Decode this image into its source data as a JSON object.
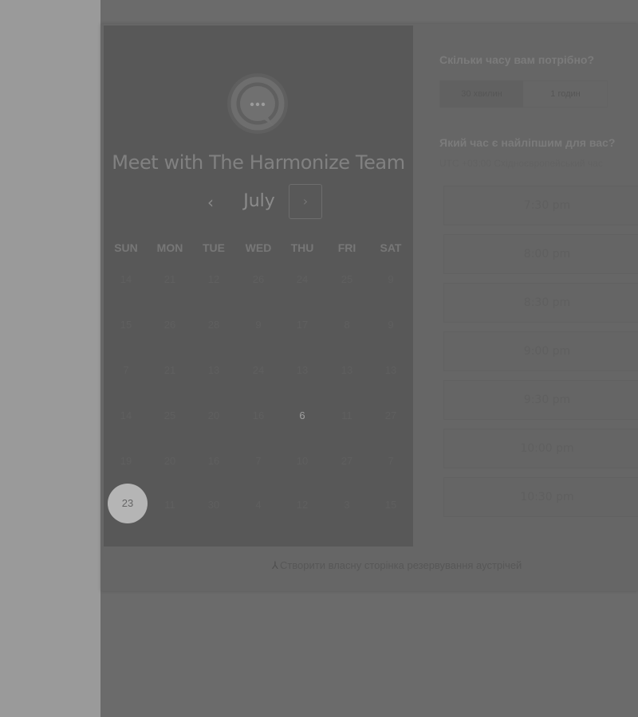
{
  "calendar": {
    "title": "Meet with The Harmonize Team",
    "month": "July",
    "prev_icon": "‹",
    "next_icon": "›",
    "weekdays": [
      "SUN",
      "MON",
      "TUE",
      "WED",
      "THU",
      "FRI",
      "SAT"
    ],
    "weeks": [
      [
        "14",
        "21",
        "12",
        "26",
        "24",
        "25",
        "9"
      ],
      [
        "15",
        "26",
        "28",
        "9",
        "17",
        "8",
        "9"
      ],
      [
        "7",
        "21",
        "13",
        "24",
        "13",
        "13",
        "13"
      ],
      [
        "14",
        "25",
        "20",
        "16",
        "6",
        "11",
        "27"
      ],
      [
        "19",
        "20",
        "16",
        "7",
        "10",
        "27",
        "7"
      ],
      [
        "23",
        "11",
        "30",
        "4",
        "12",
        "3",
        "15"
      ]
    ],
    "available_day": "6",
    "selected_day": "23"
  },
  "duration": {
    "heading": "Скільки часу вам потрібно?",
    "options": [
      "30 хвилин",
      "1 годин"
    ],
    "selected_index": 0
  },
  "time": {
    "heading": "Який час є найліпшим для вас?",
    "timezone": "UTC +03:00 Східноєвропейський час",
    "slots": [
      "7:30 pm",
      "8:00 pm",
      "8:30 pm",
      "9:00 pm",
      "9:30 pm",
      "10:00 pm",
      "10:30 pm"
    ]
  },
  "footer": {
    "link_text": "Створити власну сторінка резервування аустрічей"
  }
}
